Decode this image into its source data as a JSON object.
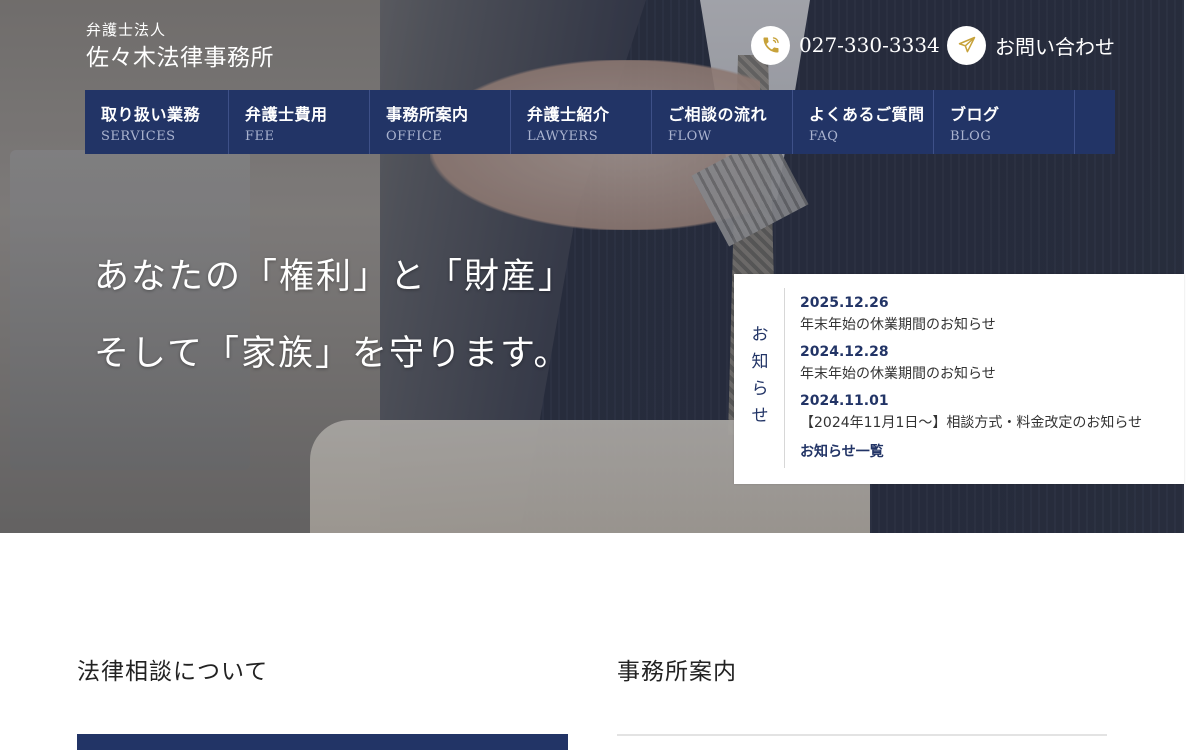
{
  "header": {
    "brand_sub": "弁護士法人",
    "brand_name": "佐々木法律事務所",
    "phone": "027-330-3334",
    "contact": "お問い合わせ"
  },
  "nav": [
    {
      "jp": "取り扱い業務",
      "en": "SERVICES"
    },
    {
      "jp": "弁護士費用",
      "en": "FEE"
    },
    {
      "jp": "事務所案内",
      "en": "OFFICE"
    },
    {
      "jp": "弁護士紹介",
      "en": "LAWYERS"
    },
    {
      "jp": "ご相談の流れ",
      "en": "FLOW"
    },
    {
      "jp": "よくあるご質問",
      "en": "FAQ"
    },
    {
      "jp": "ブログ",
      "en": "BLOG"
    }
  ],
  "hero": {
    "line1": "あなたの「権利」と「財産」",
    "line2": "そして「家族」を守ります。"
  },
  "news": {
    "title": "お知らせ",
    "items": [
      {
        "date": "2025.12.26",
        "text": "年末年始の休業期間のお知らせ"
      },
      {
        "date": "2024.12.28",
        "text": "年末年始の休業期間のお知らせ"
      },
      {
        "date": "2024.11.01",
        "text": "【2024年11月1日〜】相談方式・料金改定のお知らせ"
      }
    ],
    "more": "お知らせ一覧"
  },
  "sections": {
    "left_title": "法律相談について",
    "right_title": "事務所案内"
  },
  "colors": {
    "navy": "#223466",
    "gold": "#c7a23a"
  },
  "icons": {
    "phone": "phone-icon",
    "contact": "paper-plane-icon"
  }
}
